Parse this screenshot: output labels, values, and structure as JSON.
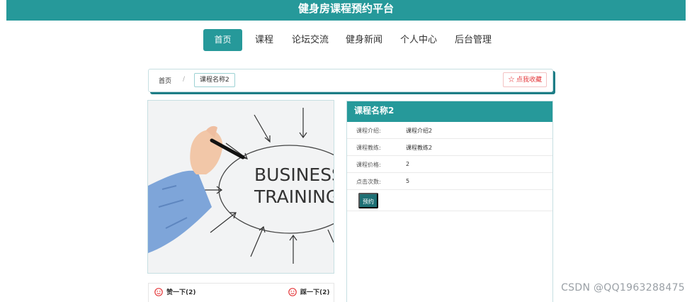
{
  "header": {
    "title": "健身房课程预约平台"
  },
  "nav": {
    "items": [
      {
        "label": "首页",
        "active": true
      },
      {
        "label": "课程",
        "active": false
      },
      {
        "label": "论坛交流",
        "active": false
      },
      {
        "label": "健身新闻",
        "active": false
      },
      {
        "label": "个人中心",
        "active": false
      },
      {
        "label": "后台管理",
        "active": false
      }
    ]
  },
  "breadcrumb": {
    "home": "首页",
    "separator": "/",
    "current": "课程名称2"
  },
  "collect": {
    "icon": "star-outline-icon",
    "label": "☆ 点我收藏"
  },
  "course_image": {
    "lines": [
      "BUSINESS",
      "TRAINING"
    ]
  },
  "detail": {
    "title": "课程名称2",
    "rows": [
      {
        "label": "课程介绍:",
        "value": "课程介绍2"
      },
      {
        "label": "课程教练:",
        "value": "课程教练2"
      },
      {
        "label": "课程价格:",
        "value": "2"
      },
      {
        "label": "点击次数:",
        "value": "5"
      }
    ],
    "book_label": "预约"
  },
  "reactions": {
    "like_label": "赞一下(2)",
    "dislike_label": "踩一下(2)",
    "icon": "smiley-icon"
  },
  "watermark": "CSDN @QQ1963288475",
  "colors": {
    "primary": "#26999a",
    "primary_dark": "#1d6f74",
    "danger": "#e4393c"
  }
}
